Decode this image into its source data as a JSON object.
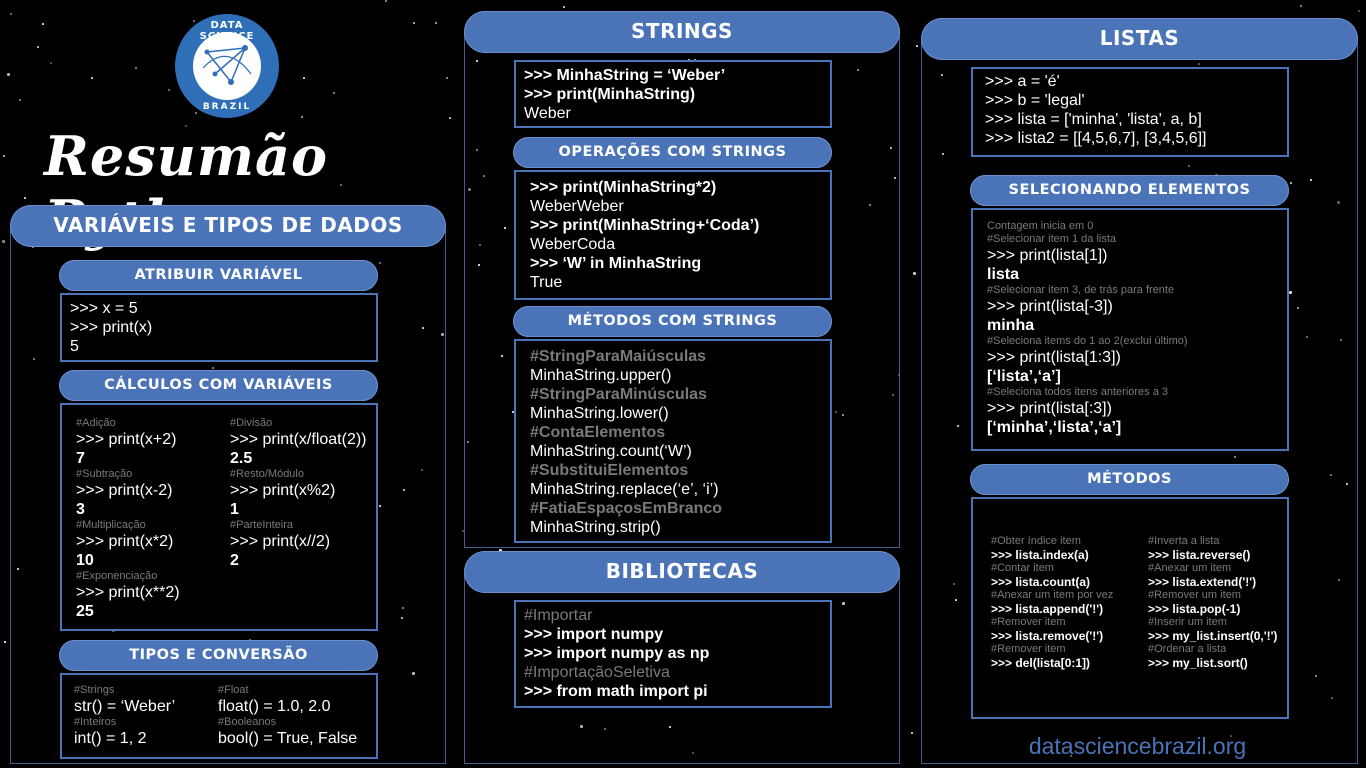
{
  "logo": {
    "top_text": "DATA SCIENCE",
    "bottom_text": "BRAZIL",
    "colors": {
      "blue": "#2f6fb8",
      "white": "#ffffff"
    }
  },
  "title": "Resumão Python",
  "footer": {
    "url": "datasciencebrazil.org"
  },
  "colors": {
    "accent": "#4a73b8",
    "panel_border": "#3f5f8f",
    "comment": "#7a7a7a"
  },
  "variaveis": {
    "header": "VARIÁVEIS E TIPOS DE DADOS",
    "atribuir": {
      "header": "ATRIBUIR VARIÁVEL",
      "lines": [
        ">>> x = 5",
        ">>> print(x)",
        "5"
      ]
    },
    "calculos": {
      "header": "CÁLCULOS COM VARIÁVEIS",
      "left": [
        {
          "comment": "#Adição",
          "code": ">>> print(x+2)",
          "result": "7"
        },
        {
          "comment": "#Subtração",
          "code": ">>> print(x-2)",
          "result": "3"
        },
        {
          "comment": "#Multiplicação",
          "code": ">>> print(x*2)",
          "result": "10"
        },
        {
          "comment": "#Exponenciação",
          "code": ">>> print(x**2)",
          "result": "25"
        }
      ],
      "right": [
        {
          "comment": "#Divisão",
          "code": ">>> print(x/float(2))",
          "result": "2.5"
        },
        {
          "comment": "#Resto/Módulo",
          "code": ">>> print(x%2)",
          "result": "1"
        },
        {
          "comment": "#ParteInteira",
          "code": ">>> print(x//2)",
          "result": "2"
        }
      ]
    },
    "tipos": {
      "header": "TIPOS E CONVERSÃO",
      "left": [
        {
          "comment": "#Strings",
          "code": "str() = ‘Weber’"
        },
        {
          "comment": "#Inteiros",
          "code": "int() = 1, 2"
        }
      ],
      "right": [
        {
          "comment": "#Float",
          "code": "float() = 1.0, 2.0"
        },
        {
          "comment": "#Booleanos",
          "code": "bool() = True, False"
        }
      ]
    }
  },
  "strings": {
    "header": "STRINGS",
    "intro": [
      ">>> MinhaString = ‘Weber’",
      ">>> print(MinhaString)",
      "Weber"
    ],
    "operacoes": {
      "header": "OPERAÇÕES COM STRINGS",
      "lines": [
        ">>> print(MinhaString*2)",
        "WeberWeber",
        ">>> print(MinhaString+‘Coda’)",
        "WeberCoda",
        ">>> ‘W’ in MinhaString",
        "True"
      ]
    },
    "metodos": {
      "header": "MÉTODOS COM STRINGS",
      "items": [
        {
          "comment": "#StringParaMaiúsculas",
          "code": "MinhaString.upper()"
        },
        {
          "comment": "#StringParaMinúsculas",
          "code": "MinhaString.lower()"
        },
        {
          "comment": "#ContaElementos",
          "code": "MinhaString.count(‘W’)"
        },
        {
          "comment": "#SubstituiElementos",
          "code": "MinhaString.replace(‘e’, ‘i’)"
        },
        {
          "comment": "#FatiaEspaçosEmBranco",
          "code": "MinhaString.strip()"
        }
      ]
    }
  },
  "bibliotecas": {
    "header": "BIBLIOTECAS",
    "lines": [
      "#Importar",
      ">>> import numpy",
      ">>> import numpy as np",
      "#ImportaçãoSeletiva",
      ">>> from math import pi"
    ]
  },
  "listas": {
    "header": "LISTAS",
    "intro": [
      ">>> a = 'é'",
      ">>> b = 'legal'",
      ">>> lista = ['minha', 'lista', a, b]",
      ">>> lista2 = [[4,5,6,7], [3,4,5,6]]"
    ],
    "selecionando": {
      "header": "SELECIONANDO ELEMENTOS",
      "note": "Contagem inicia em 0",
      "items": [
        {
          "comment": "#Selecionar item 1 da lista",
          "code": ">>> print(lista[1])",
          "result": "lista"
        },
        {
          "comment": "#Selecionar item 3, de trás para frente",
          "code": ">>> print(lista[-3])",
          "result": "minha"
        },
        {
          "comment": "#Seleciona items do 1 ao 2(exclui último)",
          "code": ">>> print(lista[1:3])",
          "result": "[‘lista’,‘a’]"
        },
        {
          "comment": "#Seleciona todos itens anteriores a 3",
          "code": ">>> print(lista[:3])",
          "result": "[‘minha’,‘lista’,‘a’]"
        }
      ]
    },
    "metodos": {
      "header": "MÉTODOS",
      "left": [
        {
          "comment": "#Obter índice item",
          "code": ">>> lista.index(a)"
        },
        {
          "comment": "#Contar item",
          "code": ">>> lista.count(a)"
        },
        {
          "comment": "#Anexar um item por vez",
          "code": ">>> lista.append('!')"
        },
        {
          "comment": "#Remover item",
          "code": ">>> lista.remove('!')"
        },
        {
          "comment": "#Remover item",
          "code": ">>> del(lista[0:1])"
        }
      ],
      "right": [
        {
          "comment": "#Inverta a lista",
          "code": ">>> lista.reverse()"
        },
        {
          "comment": "#Anexar um item",
          "code": ">>> lista.extend('!')"
        },
        {
          "comment": "#Remover um item",
          "code": ">>> lista.pop(-1)"
        },
        {
          "comment": "#Inserir um item",
          "code": ">>> my_list.insert(0,'!')"
        },
        {
          "comment": "#Ordenar a lista",
          "code": ">>> my_list.sort()"
        }
      ]
    }
  }
}
